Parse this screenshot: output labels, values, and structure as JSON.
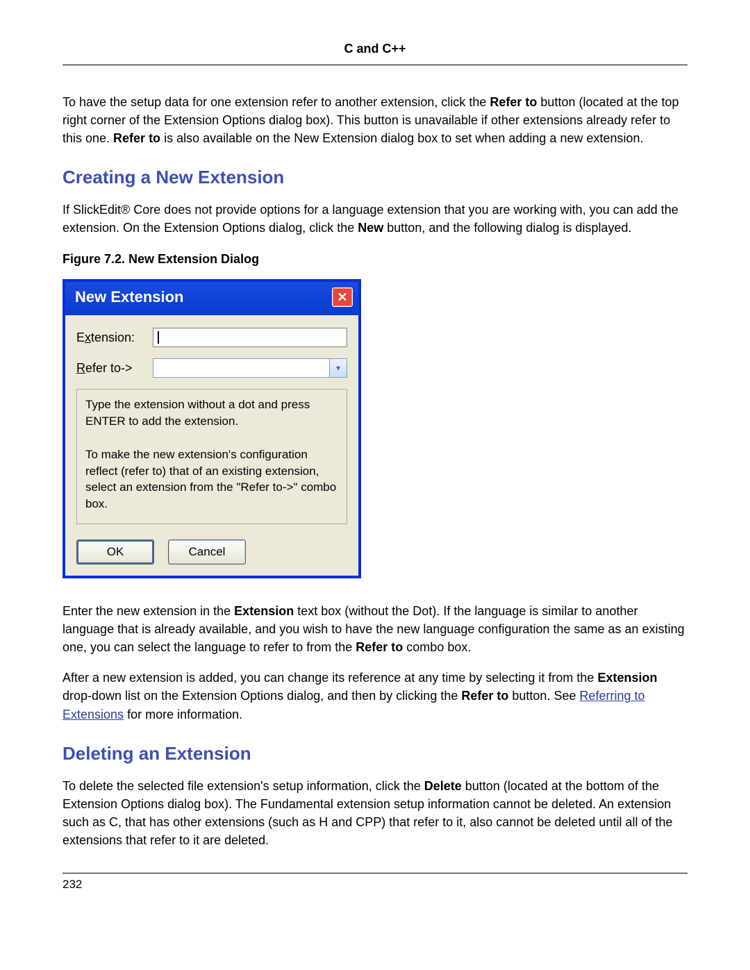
{
  "header": {
    "title": "C and C++"
  },
  "intro": {
    "t1a": "To have the setup data for one extension refer to another extension, click the ",
    "t1b": "Refer to",
    "t1c": " button (located at the top right corner of the Extension Options dialog box). This button is unavailable if other extensions already refer to this one. ",
    "t1d": "Refer to",
    "t1e": " is also available on the New Extension dialog box to set when adding a new extension."
  },
  "section1": {
    "heading": "Creating a New Extension",
    "p1a": "If SlickEdit® Core does not provide options for a language extension that you are working with, you can add the extension. On the Extension Options dialog, click the ",
    "p1b": "New",
    "p1c": " button, and the following dialog is displayed.",
    "figcaption": "Figure 7.2. New Extension Dialog"
  },
  "dialog": {
    "title": "New Extension",
    "ext_label_pre": "E",
    "ext_label_accel": "x",
    "ext_label_post": "tension:",
    "refer_label_accel": "R",
    "refer_label_post": "efer to->",
    "help1": "Type the extension without a dot and press ENTER to add the extension.",
    "help2": "To make the new extension's configuration reflect (refer to) that of an existing extension, select an extension from the \"Refer to->\" combo box.",
    "ok": "OK",
    "cancel": "Cancel"
  },
  "after": {
    "p1a": "Enter the new extension in the ",
    "p1b": "Extension",
    "p1c": " text box (without the Dot). If the language is similar to another language that is already available, and you wish to have the new language configuration the same as an existing one, you can select the language to refer to from the ",
    "p1d": "Refer to",
    "p1e": " combo box.",
    "p2a": "After a new extension is added, you can change its reference at any time by selecting it from the ",
    "p2b": "Extension",
    "p2c": " drop-down list on the Extension Options dialog, and then by clicking the ",
    "p2d": "Refer to",
    "p2e": " button. See ",
    "p2link": "Referring to Extensions",
    "p2f": " for more information."
  },
  "section2": {
    "heading": "Deleting an Extension",
    "p1a": "To delete the selected file extension's setup information, click the ",
    "p1b": "Delete",
    "p1c": " button (located at the bottom of the Extension Options dialog box). The Fundamental extension setup information cannot be deleted. An extension such as C, that has other extensions (such as H and CPP) that refer to it, also cannot be deleted until all of the extensions that refer to it are deleted."
  },
  "page_number": "232"
}
